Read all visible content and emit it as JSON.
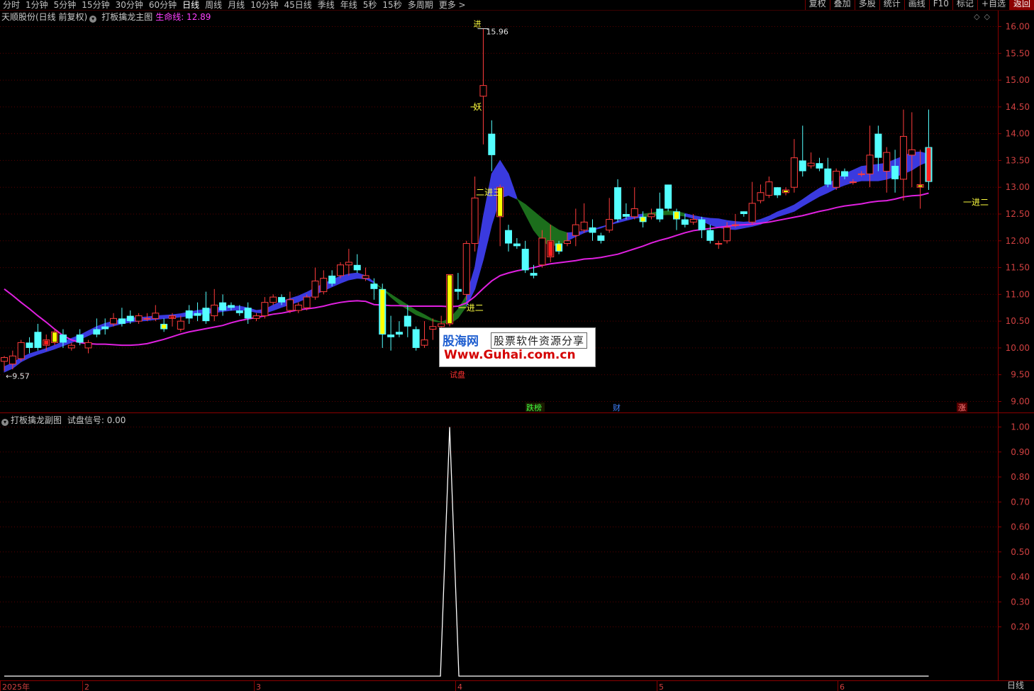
{
  "toolbar": {
    "periods": [
      "分时",
      "1分钟",
      "5分钟",
      "15分钟",
      "30分钟",
      "60分钟",
      "日线",
      "周线",
      "月线",
      "10分钟",
      "45日线",
      "季线",
      "年线",
      "5秒",
      "15秒",
      "多周期",
      "更多 >"
    ],
    "active": "日线",
    "right_buttons": [
      "复权",
      "叠加",
      "多股",
      "统计",
      "画线",
      "F10",
      "标记",
      "+自选",
      "返回"
    ]
  },
  "main": {
    "stock_title": "天顺股份(日线 前复权)",
    "indicator_name": "打板擒龙主图",
    "lifeline_label": "生命线: 12.89",
    "y_ticks": [
      "16.00",
      "15.50",
      "15.00",
      "14.50",
      "14.00",
      "13.50",
      "13.00",
      "12.50",
      "12.00",
      "11.50",
      "11.00",
      "10.50",
      "10.00",
      "9.50",
      "9.00"
    ],
    "y_values": [
      16.0,
      15.5,
      15.0,
      14.5,
      14.0,
      13.5,
      13.0,
      12.5,
      12.0,
      11.5,
      11.0,
      10.5,
      10.0,
      9.5,
      9.0
    ],
    "annotations": {
      "high": "15.96",
      "low": "←9.57",
      "yao": "妖",
      "jin": "进",
      "er_jin_san": "二进三",
      "yi_jin_er_a": "一进二",
      "yi_jin_er_b": "一进二",
      "shi_pan": "试盘"
    },
    "events": {
      "dieting": "跌榜",
      "cai": "财",
      "zhang": "涨"
    }
  },
  "sub": {
    "indicator_name": "打板擒龙副图",
    "signal_label": "试盘信号: 0.00",
    "y_ticks": [
      "1.00",
      "0.90",
      "0.80",
      "0.70",
      "0.60",
      "0.50",
      "0.40",
      "0.30",
      "0.20"
    ],
    "y_values": [
      1.0,
      0.9,
      0.8,
      0.7,
      0.6,
      0.5,
      0.4,
      0.3,
      0.2
    ]
  },
  "x_axis": {
    "labels": [
      "2025年",
      "2",
      "3",
      "4",
      "5",
      "6"
    ],
    "period_label": "日线"
  },
  "watermark": {
    "brand": "股海网",
    "slogan": "股票软件资源分享",
    "url": "Www.Guhai.com.cn"
  },
  "chart_data": {
    "type": "candlestick",
    "ylim": [
      9.0,
      16.0
    ],
    "candles": [
      [
        9.75,
        9.82,
        9.57,
        9.85
      ],
      [
        9.7,
        9.85,
        9.6,
        9.95
      ],
      [
        9.8,
        10.1,
        9.75,
        10.15
      ],
      [
        10.1,
        10.0,
        9.9,
        10.2
      ],
      [
        10.3,
        10.0,
        9.95,
        10.45
      ],
      [
        10.05,
        10.15,
        9.95,
        10.25
      ],
      [
        10.1,
        10.3,
        10.05,
        10.35
      ],
      [
        10.25,
        10.1,
        10.0,
        10.35
      ],
      [
        10.0,
        10.05,
        9.95,
        10.1
      ],
      [
        10.25,
        10.1,
        10.05,
        10.35
      ],
      [
        10.0,
        10.1,
        9.9,
        10.15
      ],
      [
        10.35,
        10.25,
        10.2,
        10.55
      ],
      [
        10.4,
        10.35,
        10.25,
        10.55
      ],
      [
        10.45,
        10.55,
        10.4,
        10.65
      ],
      [
        10.55,
        10.45,
        10.4,
        10.75
      ],
      [
        10.6,
        10.5,
        10.45,
        10.7
      ],
      [
        10.5,
        10.6,
        10.45,
        10.65
      ],
      [
        10.55,
        10.55,
        10.5,
        10.65
      ],
      [
        10.55,
        10.65,
        10.5,
        10.8
      ],
      [
        10.45,
        10.35,
        10.3,
        10.55
      ],
      [
        10.55,
        10.6,
        10.4,
        10.65
      ],
      [
        10.35,
        10.5,
        10.3,
        10.6
      ],
      [
        10.7,
        10.55,
        10.45,
        10.8
      ],
      [
        10.65,
        10.6,
        10.5,
        10.85
      ],
      [
        10.75,
        10.5,
        10.45,
        11.05
      ],
      [
        10.6,
        10.8,
        10.5,
        11.1
      ],
      [
        10.85,
        10.7,
        10.6,
        11.0
      ],
      [
        10.8,
        10.75,
        10.7,
        10.85
      ],
      [
        10.7,
        10.65,
        10.6,
        10.8
      ],
      [
        10.75,
        10.55,
        10.45,
        10.85
      ],
      [
        10.55,
        10.6,
        10.5,
        10.65
      ],
      [
        10.6,
        10.85,
        10.55,
        10.95
      ],
      [
        10.85,
        10.95,
        10.8,
        11.0
      ],
      [
        10.95,
        10.85,
        10.8,
        11.0
      ],
      [
        10.7,
        10.9,
        10.65,
        11.05
      ],
      [
        10.7,
        10.8,
        10.65,
        10.85
      ],
      [
        10.75,
        10.95,
        10.7,
        11.0
      ],
      [
        10.95,
        11.25,
        10.9,
        11.5
      ],
      [
        11.05,
        11.3,
        11.0,
        11.45
      ],
      [
        11.35,
        11.2,
        11.15,
        11.45
      ],
      [
        11.35,
        11.55,
        11.3,
        11.6
      ],
      [
        11.55,
        11.6,
        11.35,
        11.85
      ],
      [
        11.55,
        11.45,
        11.4,
        11.75
      ],
      [
        11.3,
        11.35,
        11.25,
        11.5
      ],
      [
        11.2,
        11.1,
        10.9,
        11.3
      ],
      [
        11.1,
        10.25,
        10.0,
        11.2
      ],
      [
        10.25,
        10.2,
        9.95,
        10.6
      ],
      [
        10.3,
        10.25,
        10.2,
        10.5
      ],
      [
        10.6,
        10.4,
        10.2,
        10.8
      ],
      [
        10.35,
        10.0,
        9.95,
        10.4
      ],
      [
        10.05,
        10.15,
        10.0,
        10.5
      ],
      [
        10.35,
        10.4,
        10.15,
        10.55
      ],
      [
        10.4,
        10.45,
        10.3,
        10.6
      ],
      [
        10.45,
        11.37,
        10.4,
        11.37
      ],
      [
        11.1,
        11.05,
        10.9,
        11.4
      ],
      [
        11.0,
        11.95,
        10.9,
        12.0
      ],
      [
        11.95,
        12.8,
        11.8,
        13.2
      ],
      [
        14.7,
        14.9,
        13.8,
        15.96
      ],
      [
        14.0,
        13.6,
        13.3,
        14.25
      ],
      [
        12.45,
        13.0,
        11.9,
        13.05
      ],
      [
        12.2,
        11.95,
        11.8,
        12.3
      ],
      [
        11.95,
        11.9,
        11.85,
        12.05
      ],
      [
        11.85,
        11.45,
        11.4,
        12.0
      ],
      [
        11.4,
        11.35,
        11.3,
        11.55
      ],
      [
        11.55,
        12.05,
        11.5,
        12.2
      ],
      [
        11.7,
        12.0,
        11.6,
        12.3
      ],
      [
        11.95,
        11.8,
        11.75,
        12.0
      ],
      [
        11.95,
        12.0,
        11.9,
        12.15
      ],
      [
        12.1,
        12.3,
        11.9,
        12.6
      ],
      [
        12.2,
        12.35,
        12.15,
        12.7
      ],
      [
        12.25,
        12.15,
        12.0,
        12.4
      ],
      [
        12.1,
        12.0,
        11.95,
        12.15
      ],
      [
        12.2,
        12.4,
        12.15,
        12.8
      ],
      [
        13.0,
        12.4,
        12.35,
        13.15
      ],
      [
        12.5,
        12.45,
        12.4,
        12.7
      ],
      [
        12.45,
        12.6,
        12.4,
        13.0
      ],
      [
        12.45,
        12.35,
        12.25,
        12.55
      ],
      [
        12.45,
        12.5,
        12.4,
        12.6
      ],
      [
        12.6,
        12.4,
        12.35,
        12.9
      ],
      [
        13.05,
        12.6,
        12.55,
        13.05
      ],
      [
        12.55,
        12.4,
        12.2,
        12.6
      ],
      [
        12.4,
        12.3,
        12.25,
        12.5
      ],
      [
        12.35,
        12.4,
        12.3,
        12.5
      ],
      [
        12.4,
        12.2,
        12.05,
        12.45
      ],
      [
        12.2,
        12.0,
        11.95,
        12.3
      ],
      [
        11.95,
        11.95,
        11.85,
        12.0
      ],
      [
        12.0,
        12.25,
        11.95,
        12.35
      ],
      [
        12.3,
        12.3,
        12.25,
        12.5
      ],
      [
        12.55,
        12.5,
        12.45,
        12.55
      ],
      [
        12.35,
        12.7,
        12.3,
        13.1
      ],
      [
        12.75,
        12.9,
        12.7,
        13.05
      ],
      [
        12.85,
        13.1,
        12.8,
        13.2
      ],
      [
        13.0,
        12.85,
        12.8,
        13.0
      ],
      [
        12.9,
        12.95,
        12.85,
        13.0
      ],
      [
        13.0,
        13.55,
        12.9,
        13.9
      ],
      [
        13.5,
        13.3,
        13.2,
        14.15
      ],
      [
        13.4,
        13.45,
        13.35,
        13.65
      ],
      [
        13.45,
        13.35,
        13.3,
        13.55
      ],
      [
        13.35,
        13.05,
        13.0,
        13.55
      ],
      [
        13.0,
        13.3,
        12.95,
        13.35
      ],
      [
        13.3,
        13.2,
        13.15,
        13.35
      ],
      [
        13.1,
        13.1,
        13.05,
        13.15
      ],
      [
        13.25,
        13.25,
        13.2,
        13.3
      ],
      [
        13.25,
        13.6,
        13.0,
        14.15
      ],
      [
        14.0,
        13.55,
        13.3,
        14.15
      ],
      [
        13.3,
        13.65,
        12.9,
        13.75
      ],
      [
        13.4,
        13.15,
        12.9,
        13.7
      ],
      [
        13.15,
        13.95,
        12.75,
        14.45
      ],
      [
        13.6,
        13.7,
        13.0,
        14.4
      ],
      [
        13.0,
        13.05,
        12.6,
        13.7
      ],
      [
        13.75,
        13.1,
        12.95,
        14.45
      ]
    ],
    "lifeline": [
      11.1,
      10.98,
      10.85,
      10.73,
      10.6,
      10.48,
      10.35,
      10.23,
      10.15,
      10.1,
      10.08,
      10.07,
      10.07,
      10.06,
      10.05,
      10.05,
      10.06,
      10.08,
      10.12,
      10.16,
      10.21,
      10.26,
      10.3,
      10.33,
      10.36,
      10.39,
      10.42,
      10.47,
      10.51,
      10.54,
      10.57,
      10.6,
      10.63,
      10.65,
      10.68,
      10.71,
      10.73,
      10.75,
      10.78,
      10.82,
      10.85,
      10.87,
      10.88,
      10.87,
      10.81,
      10.8,
      10.79,
      10.79,
      10.78,
      10.78,
      10.78,
      10.78,
      10.78,
      10.77,
      10.78,
      10.84,
      10.96,
      11.11,
      11.25,
      11.35,
      11.4,
      11.44,
      11.47,
      11.5,
      11.54,
      11.57,
      11.59,
      11.61,
      11.63,
      11.66,
      11.67,
      11.69,
      11.72,
      11.75,
      11.8,
      11.85,
      11.9,
      11.96,
      12.01,
      12.05,
      12.1,
      12.15,
      12.19,
      12.21,
      12.23,
      12.25,
      12.27,
      12.29,
      12.3,
      12.31,
      12.33,
      12.35,
      12.38,
      12.41,
      12.44,
      12.47,
      12.51,
      12.55,
      12.58,
      12.62,
      12.65,
      12.67,
      12.69,
      12.72,
      12.74,
      12.75,
      12.78,
      12.82,
      12.84,
      12.85,
      12.89
    ],
    "ribbon_upper": [
      9.65,
      9.72,
      9.82,
      9.89,
      9.94,
      9.99,
      10.05,
      10.12,
      10.18,
      10.24,
      10.32,
      10.4,
      10.46,
      10.5,
      10.53,
      10.56,
      10.57,
      10.58,
      10.6,
      10.61,
      10.62,
      10.64,
      10.67,
      10.7,
      10.72,
      10.74,
      10.77,
      10.78,
      10.78,
      10.75,
      10.7,
      10.72,
      10.8,
      10.87,
      10.92,
      10.97,
      11.04,
      11.12,
      11.2,
      11.27,
      11.34,
      11.38,
      11.4,
      11.35,
      11.23,
      11.1,
      10.95,
      10.82,
      10.72,
      10.62,
      10.56,
      10.5,
      10.48,
      10.55,
      10.72,
      10.98,
      11.5,
      12.45,
      13.25,
      13.5,
      13.25,
      12.8,
      12.5,
      12.2,
      12.0,
      11.9,
      11.93,
      12.0,
      12.08,
      12.15,
      12.2,
      12.24,
      12.3,
      12.37,
      12.43,
      12.48,
      12.5,
      12.52,
      12.55,
      12.56,
      12.55,
      12.51,
      12.47,
      12.44,
      12.42,
      12.41,
      12.38,
      12.36,
      12.35,
      12.36,
      12.4,
      12.46,
      12.54,
      12.6,
      12.67,
      12.77,
      12.88,
      12.98,
      13.06,
      13.16,
      13.25,
      13.32,
      13.39,
      13.41,
      13.43,
      13.45,
      13.52,
      13.58,
      13.65,
      13.66,
      13.62
    ],
    "ribbon_lower": [
      9.55,
      9.62,
      9.74,
      9.82,
      9.88,
      9.93,
      9.98,
      10.04,
      10.1,
      10.16,
      10.23,
      10.3,
      10.37,
      10.41,
      10.45,
      10.48,
      10.5,
      10.51,
      10.53,
      10.55,
      10.56,
      10.58,
      10.6,
      10.62,
      10.64,
      10.66,
      10.68,
      10.7,
      10.71,
      10.7,
      10.66,
      10.65,
      10.7,
      10.76,
      10.81,
      10.86,
      10.93,
      11.0,
      11.07,
      11.14,
      11.21,
      11.27,
      11.3,
      11.29,
      11.21,
      11.1,
      11.0,
      10.9,
      10.8,
      10.7,
      10.62,
      10.53,
      10.48,
      10.45,
      10.56,
      10.78,
      11.1,
      11.65,
      12.3,
      12.8,
      12.85,
      12.78,
      12.68,
      12.55,
      12.42,
      12.3,
      12.2,
      12.15,
      12.16,
      12.18,
      12.21,
      12.26,
      12.3,
      12.34,
      12.38,
      12.42,
      12.44,
      12.47,
      12.48,
      12.49,
      12.48,
      12.46,
      12.42,
      12.37,
      12.3,
      12.25,
      12.22,
      12.21,
      12.24,
      12.27,
      12.31,
      12.38,
      12.45,
      12.5,
      12.55,
      12.65,
      12.74,
      12.83,
      12.9,
      12.98,
      13.04,
      13.09,
      13.12,
      13.12,
      13.12,
      13.15,
      13.2,
      13.25,
      13.32,
      13.42,
      13.48
    ],
    "ribbon_green": [
      [
        44,
        55
      ],
      [
        61,
        67
      ],
      [
        76,
        81
      ]
    ],
    "sub_signal_peak_index": 53,
    "sub_signal_peak_value": 1.0
  }
}
